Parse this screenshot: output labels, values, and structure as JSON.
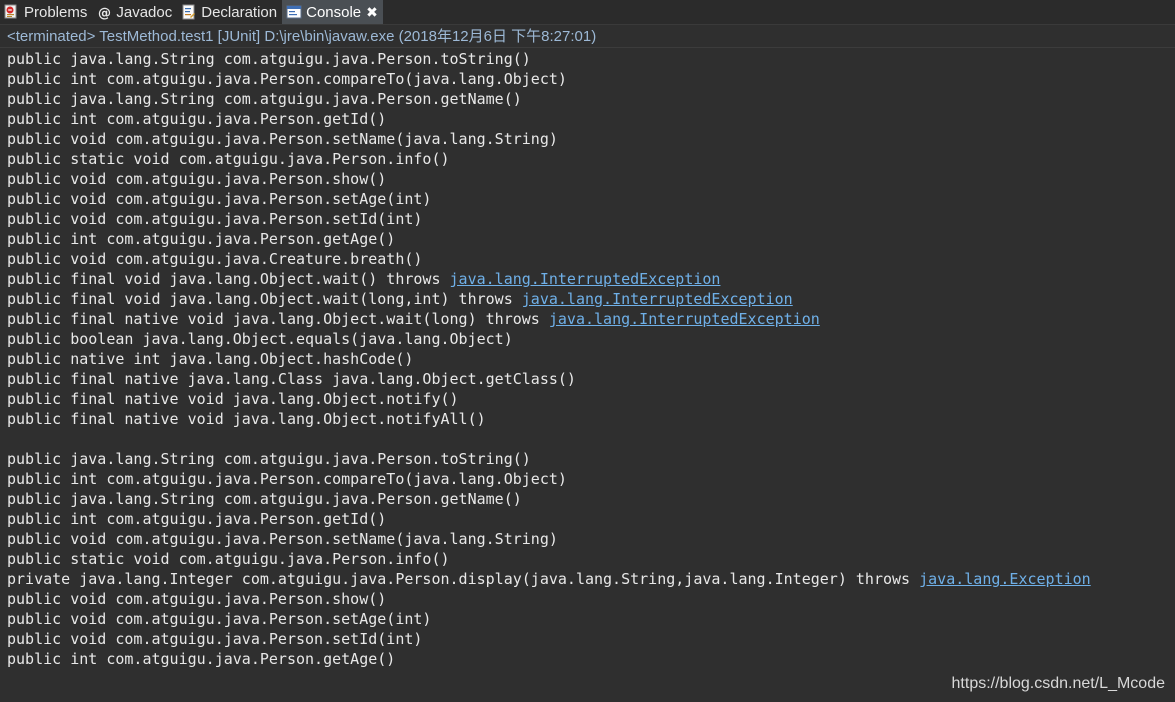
{
  "tabs": [
    {
      "label": "Problems",
      "icon": "problems-icon",
      "active": false
    },
    {
      "label": "Javadoc",
      "icon": "javadoc-icon",
      "active": false
    },
    {
      "label": "Declaration",
      "icon": "declaration-icon",
      "active": false
    },
    {
      "label": "Console",
      "icon": "console-icon",
      "active": true,
      "close": "✖"
    }
  ],
  "status": "<terminated> TestMethod.test1 [JUnit] D:\\jre\\bin\\javaw.exe (2018年12月6日 下午8:27:01)",
  "lines": [
    {
      "text": "public java.lang.String com.atguigu.java.Person.toString()"
    },
    {
      "text": "public int com.atguigu.java.Person.compareTo(java.lang.Object)"
    },
    {
      "text": "public java.lang.String com.atguigu.java.Person.getName()"
    },
    {
      "text": "public int com.atguigu.java.Person.getId()"
    },
    {
      "text": "public void com.atguigu.java.Person.setName(java.lang.String)"
    },
    {
      "text": "public static void com.atguigu.java.Person.info()"
    },
    {
      "text": "public void com.atguigu.java.Person.show()"
    },
    {
      "text": "public void com.atguigu.java.Person.setAge(int)"
    },
    {
      "text": "public void com.atguigu.java.Person.setId(int)"
    },
    {
      "text": "public int com.atguigu.java.Person.getAge()"
    },
    {
      "text": "public void com.atguigu.java.Creature.breath()"
    },
    {
      "text": "public final void java.lang.Object.wait() throws ",
      "link": "java.lang.InterruptedException"
    },
    {
      "text": "public final void java.lang.Object.wait(long,int) throws ",
      "link": "java.lang.InterruptedException"
    },
    {
      "text": "public final native void java.lang.Object.wait(long) throws ",
      "link": "java.lang.InterruptedException"
    },
    {
      "text": "public boolean java.lang.Object.equals(java.lang.Object)"
    },
    {
      "text": "public native int java.lang.Object.hashCode()"
    },
    {
      "text": "public final native java.lang.Class java.lang.Object.getClass()"
    },
    {
      "text": "public final native void java.lang.Object.notify()"
    },
    {
      "text": "public final native void java.lang.Object.notifyAll()"
    },
    {
      "text": ""
    },
    {
      "text": "public java.lang.String com.atguigu.java.Person.toString()"
    },
    {
      "text": "public int com.atguigu.java.Person.compareTo(java.lang.Object)"
    },
    {
      "text": "public java.lang.String com.atguigu.java.Person.getName()"
    },
    {
      "text": "public int com.atguigu.java.Person.getId()"
    },
    {
      "text": "public void com.atguigu.java.Person.setName(java.lang.String)"
    },
    {
      "text": "public static void com.atguigu.java.Person.info()"
    },
    {
      "text": "private java.lang.Integer com.atguigu.java.Person.display(java.lang.String,java.lang.Integer) throws ",
      "link": "java.lang.Exception"
    },
    {
      "text": "public void com.atguigu.java.Person.show()"
    },
    {
      "text": "public void com.atguigu.java.Person.setAge(int)"
    },
    {
      "text": "public void com.atguigu.java.Person.setId(int)"
    },
    {
      "text": "public int com.atguigu.java.Person.getAge()"
    }
  ],
  "watermark": "https://blog.csdn.net/L_Mcode"
}
